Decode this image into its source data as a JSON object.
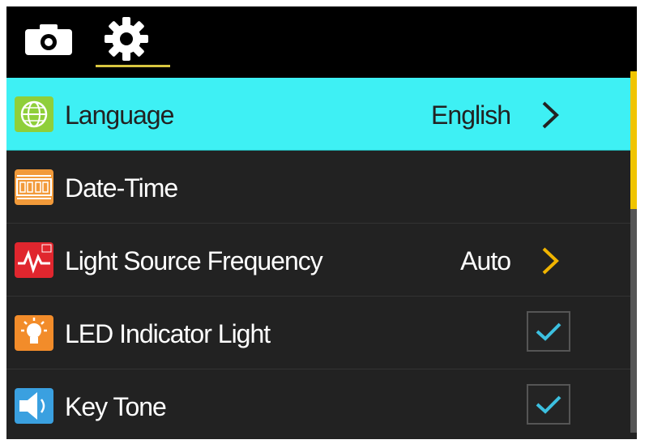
{
  "tabs": [
    {
      "icon": "camera-icon"
    },
    {
      "icon": "gear-icon",
      "active": true
    }
  ],
  "colors": {
    "selected_row": "#3ef0f4",
    "accent_underline": "#d8c640",
    "scroll_thumb": "#f0c400",
    "checkbox_check": "#3cc0e0",
    "chevron_active": "#f0b400"
  },
  "settings": {
    "items": [
      {
        "label": "Language",
        "value": "English",
        "icon": "globe-icon",
        "control": "chevron"
      },
      {
        "label": "Date-Time",
        "value": "",
        "icon": "calendar-icon",
        "control": "none"
      },
      {
        "label": "Light Source Frequency",
        "value": "Auto",
        "icon": "frequency-icon",
        "control": "chevron"
      },
      {
        "label": "LED Indicator Light",
        "value": "",
        "icon": "led-icon",
        "control": "checkbox",
        "checked": true
      },
      {
        "label": "Key Tone",
        "value": "",
        "icon": "speaker-icon",
        "control": "checkbox",
        "checked": true
      }
    ]
  }
}
